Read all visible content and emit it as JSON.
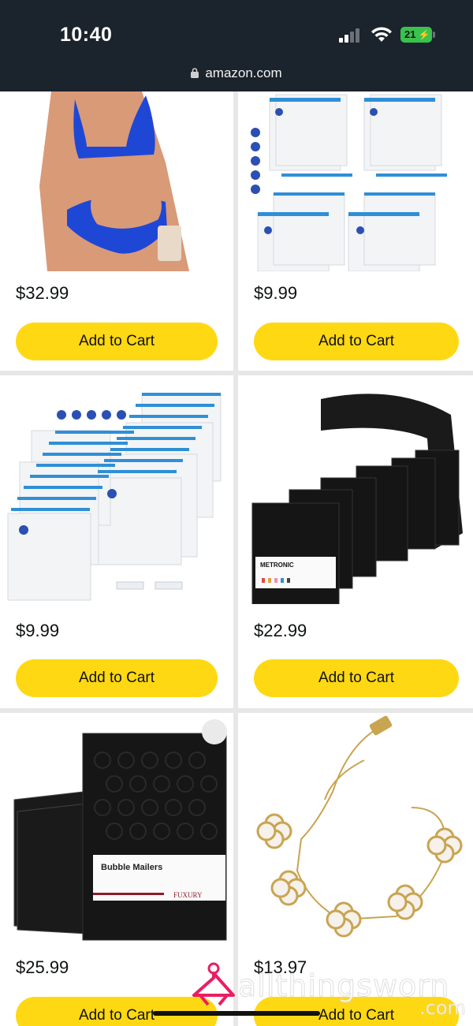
{
  "status_bar": {
    "time": "10:40",
    "battery": "21",
    "url": "amazon.com",
    "icons": [
      "signal-icon",
      "wifi-icon",
      "battery-charging-icon",
      "lock-icon"
    ]
  },
  "products": [
    {
      "price": "$32.99",
      "button": "Add to Cart",
      "image": "blue-maternity-bikini"
    },
    {
      "price": "$9.99",
      "button": "Add to Cart",
      "image": "clear-ziplock-bags"
    },
    {
      "price": "$9.99",
      "button": "Add to Cart",
      "image": "clear-ziplock-bags-stack"
    },
    {
      "price": "$22.99",
      "button": "Add to Cart",
      "image": "black-bubble-mailers",
      "label": "METRONIC"
    },
    {
      "price": "$25.99",
      "button": "Add to Cart",
      "image": "black-bubble-mailers-fuxury",
      "label": "Bubble Mailers",
      "brand": "FUXURY"
    },
    {
      "price": "$13.97",
      "button": "Add to Cart",
      "image": "clover-bracelet"
    }
  ],
  "watermark": {
    "text": "allthingsworn",
    "suffix": ".com"
  },
  "colors": {
    "button": "#ffd814",
    "statusbar": "#1b232c",
    "battery": "#39c24e",
    "watermark_pink": "#e91e63"
  }
}
